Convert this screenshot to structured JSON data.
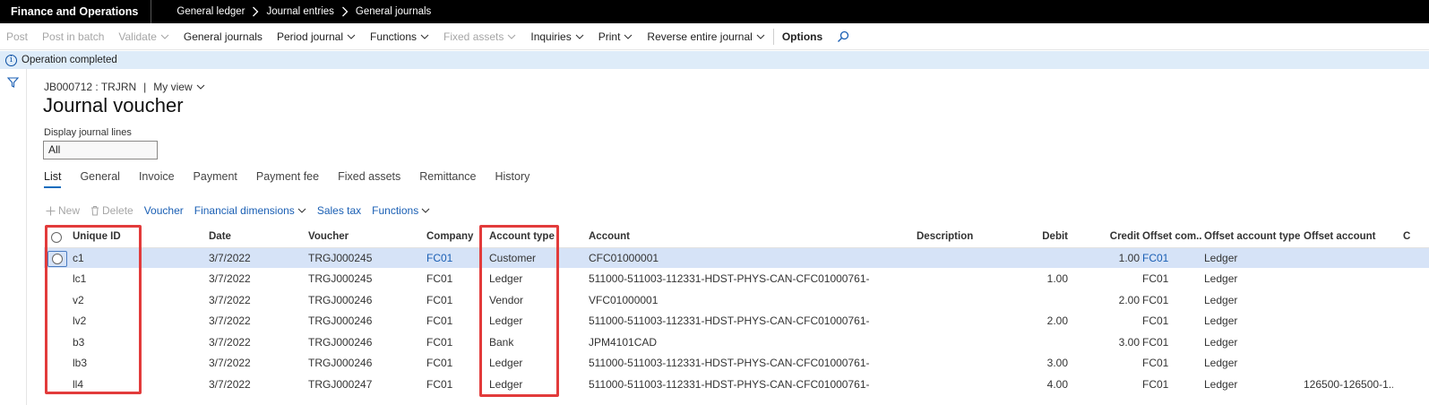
{
  "app": {
    "title": "Finance and Operations",
    "breadcrumbs": [
      "General ledger",
      "Journal entries",
      "General journals"
    ]
  },
  "actions": [
    {
      "label": "Post",
      "disabled": true,
      "dropdown": false
    },
    {
      "label": "Post in batch",
      "disabled": true,
      "dropdown": false
    },
    {
      "label": "Validate",
      "disabled": true,
      "dropdown": true
    },
    {
      "label": "General journals",
      "disabled": false,
      "dropdown": false
    },
    {
      "label": "Period journal",
      "disabled": false,
      "dropdown": true
    },
    {
      "label": "Functions",
      "disabled": false,
      "dropdown": true
    },
    {
      "label": "Fixed assets",
      "disabled": true,
      "dropdown": true
    },
    {
      "label": "Inquiries",
      "disabled": false,
      "dropdown": true
    },
    {
      "label": "Print",
      "disabled": false,
      "dropdown": true
    },
    {
      "label": "Reverse entire journal",
      "disabled": false,
      "dropdown": true
    }
  ],
  "options_label": "Options",
  "message": "Operation completed",
  "record": {
    "id": "JB000712 : TRJRN",
    "view": "My view"
  },
  "page_title": "Journal voucher",
  "display_lines": {
    "label": "Display journal lines",
    "value": "All"
  },
  "tabs": [
    "List",
    "General",
    "Invoice",
    "Payment",
    "Payment fee",
    "Fixed assets",
    "Remittance",
    "History"
  ],
  "grid_toolbar": {
    "new": "New",
    "delete": "Delete",
    "voucher": "Voucher",
    "financial_dimensions": "Financial dimensions",
    "sales_tax": "Sales tax",
    "functions": "Functions"
  },
  "columns": [
    "Unique ID",
    "Date",
    "Voucher",
    "Company",
    "Account type",
    "Account",
    "Description",
    "Debit",
    "Credit",
    "Offset com...",
    "Offset account type",
    "Offset account",
    "C"
  ],
  "rows": [
    {
      "uid": "c1",
      "date": "3/7/2022",
      "voucher": "TRGJ000245",
      "company": "FC01",
      "account_type": "Customer",
      "account": "CFC01000001",
      "description": "",
      "debit": "",
      "credit": "1.00",
      "offset_company": "FC01",
      "offset_type": "Ledger",
      "offset_account": ""
    },
    {
      "uid": "lc1",
      "date": "3/7/2022",
      "voucher": "TRGJ000245",
      "company": "FC01",
      "account_type": "Ledger",
      "account": "511000-511003-112331-HDST-PHYS-CAN-CFC01000761-",
      "description": "",
      "debit": "1.00",
      "credit": "",
      "offset_company": "FC01",
      "offset_type": "Ledger",
      "offset_account": ""
    },
    {
      "uid": "v2",
      "date": "3/7/2022",
      "voucher": "TRGJ000246",
      "company": "FC01",
      "account_type": "Vendor",
      "account": "VFC01000001",
      "description": "",
      "debit": "",
      "credit": "2.00",
      "offset_company": "FC01",
      "offset_type": "Ledger",
      "offset_account": ""
    },
    {
      "uid": "lv2",
      "date": "3/7/2022",
      "voucher": "TRGJ000246",
      "company": "FC01",
      "account_type": "Ledger",
      "account": "511000-511003-112331-HDST-PHYS-CAN-CFC01000761-",
      "description": "",
      "debit": "2.00",
      "credit": "",
      "offset_company": "FC01",
      "offset_type": "Ledger",
      "offset_account": ""
    },
    {
      "uid": "b3",
      "date": "3/7/2022",
      "voucher": "TRGJ000246",
      "company": "FC01",
      "account_type": "Bank",
      "account": "JPM4101CAD",
      "description": "",
      "debit": "",
      "credit": "3.00",
      "offset_company": "FC01",
      "offset_type": "Ledger",
      "offset_account": ""
    },
    {
      "uid": "lb3",
      "date": "3/7/2022",
      "voucher": "TRGJ000246",
      "company": "FC01",
      "account_type": "Ledger",
      "account": "511000-511003-112331-HDST-PHYS-CAN-CFC01000761-",
      "description": "",
      "debit": "3.00",
      "credit": "",
      "offset_company": "FC01",
      "offset_type": "Ledger",
      "offset_account": ""
    },
    {
      "uid": "ll4",
      "date": "3/7/2022",
      "voucher": "TRGJ000247",
      "company": "FC01",
      "account_type": "Ledger",
      "account": "511000-511003-112331-HDST-PHYS-CAN-CFC01000761-",
      "description": "",
      "debit": "4.00",
      "credit": "",
      "offset_company": "FC01",
      "offset_type": "Ledger",
      "offset_account": "126500-126500-1..."
    }
  ],
  "colors": {
    "accent": "#0f6cbd",
    "link": "#1a5fb4",
    "selected_row": "#d6e3f7",
    "message_bg": "#deecf9",
    "highlight": "#e23b3b"
  }
}
